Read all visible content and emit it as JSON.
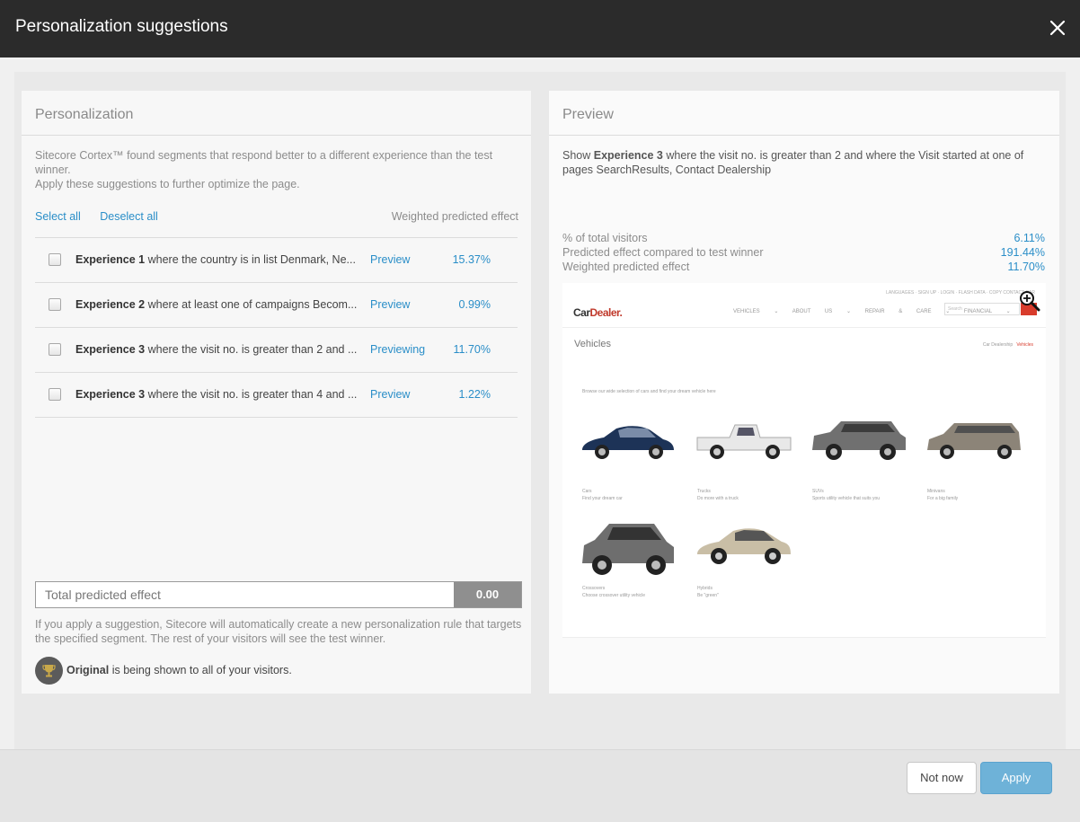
{
  "dialog": {
    "title": "Personalization suggestions"
  },
  "personalization": {
    "heading": "Personalization",
    "intro_line1": "Sitecore Cortex™ found segments that respond better to a different experience than the test winner.",
    "intro_line2": "Apply these suggestions to further optimize the page.",
    "select_all": "Select all",
    "deselect_all": "Deselect all",
    "column_header": "Weighted predicted effect",
    "rows": [
      {
        "experience": "Experience 1",
        "text": " where the country is in list Denmark, Ne...",
        "action": "Preview",
        "effect": "15.37%",
        "checked": false
      },
      {
        "experience": "Experience 2",
        "text": " where at least one of campaigns Becom...",
        "action": "Preview",
        "effect": "0.99%",
        "checked": false
      },
      {
        "experience": "Experience 3",
        "text": " where the visit no. is greater than 2 and ...",
        "action": "Previewing",
        "effect": "11.70%",
        "checked": false
      },
      {
        "experience": "Experience 3",
        "text": " where the visit no. is greater than 4 and ...",
        "action": "Preview",
        "effect": "1.22%",
        "checked": false
      }
    ],
    "total_label": "Total predicted effect",
    "total_value": "0.00",
    "note": "If you apply a suggestion, Sitecore will automatically create a new personalization rule that targets the specified segment. The rest of your visitors will see the test winner.",
    "original_name": "Original",
    "original_text": " is being shown to all of your visitors."
  },
  "preview": {
    "heading": "Preview",
    "show_prefix": "Show ",
    "show_experience": "Experience 3",
    "show_rest": " where the visit no. is greater than 2 and where the Visit started at one of pages SearchResults, Contact Dealership",
    "stats": [
      {
        "label": "% of total visitors",
        "value": "6.11%"
      },
      {
        "label": "Predicted effect compared to test winner",
        "value": "191.44%"
      },
      {
        "label": "Weighted predicted effect",
        "value": "11.70%"
      }
    ],
    "site": {
      "logo_a": "Car",
      "logo_b": "Dealer.",
      "top_links": "LANGUAGES · SIGN UP · LOGIN · FLASH DATA · COPY CONTACT CAR",
      "nav": "VEHICLES ⌄ ABOUT US ⌄ REPAIR & CARE ⌄ FINANCIAL ⌄",
      "search_placeholder": "Search",
      "page_heading": "Vehicles",
      "breadcrumb_home": "Car Dealership",
      "breadcrumb_current": "Vehicles",
      "intro": "Browse our wide selection of cars and find your dream vehicle here",
      "categories": [
        {
          "name": "Cars",
          "tagline": "Find your dream car",
          "color": "#1d3357"
        },
        {
          "name": "Trucks",
          "tagline": "Do more with a truck",
          "color": "#e8e8e8"
        },
        {
          "name": "SUVs",
          "tagline": "Sports utility vehicle that suits you",
          "color": "#707070"
        },
        {
          "name": "Minivans",
          "tagline": "For a big family",
          "color": "#8c8478"
        },
        {
          "name": "Crossovers",
          "tagline": "Choose crossover utility vehicle",
          "color": "#6e6e6e"
        },
        {
          "name": "Hybrids",
          "tagline": "Be \"green\"",
          "color": "#c9bea6"
        }
      ]
    }
  },
  "footer": {
    "not_now": "Not now",
    "apply": "Apply"
  },
  "colors": {
    "accent": "#2a8ec8",
    "apply_button": "#6eb2d8",
    "titlebar": "#2b2b2b"
  }
}
